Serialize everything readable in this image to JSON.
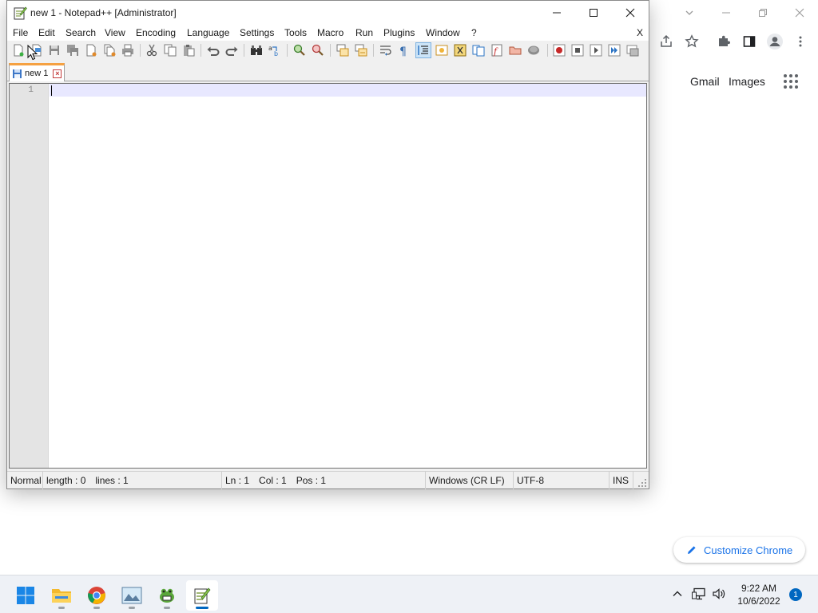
{
  "chrome": {
    "links": {
      "gmail": "Gmail",
      "images": "Images"
    },
    "customize_label": "Customize Chrome"
  },
  "npp": {
    "title": "new 1 - Notepad++ [Administrator]",
    "menu": [
      "File",
      "Edit",
      "Search",
      "View",
      "Encoding",
      "Language",
      "Settings",
      "Tools",
      "Macro",
      "Run",
      "Plugins",
      "Window",
      "?"
    ],
    "menu_close": "X",
    "tab_label": "new 1",
    "line_number": "1",
    "status": {
      "mode": "Normal",
      "length": "length : 0",
      "lines": "lines : 1",
      "ln": "Ln : 1",
      "col": "Col : 1",
      "pos": "Pos : 1",
      "eol": "Windows (CR LF)",
      "encoding": "UTF-8",
      "ins": "INS"
    }
  },
  "taskbar": {
    "time": "9:22 AM",
    "date": "10/6/2022",
    "notification_count": "1"
  },
  "colors": {
    "accent_tab": "#f5a142",
    "taskbar_active": "#0067c0",
    "chrome_link": "#1a73e8"
  }
}
